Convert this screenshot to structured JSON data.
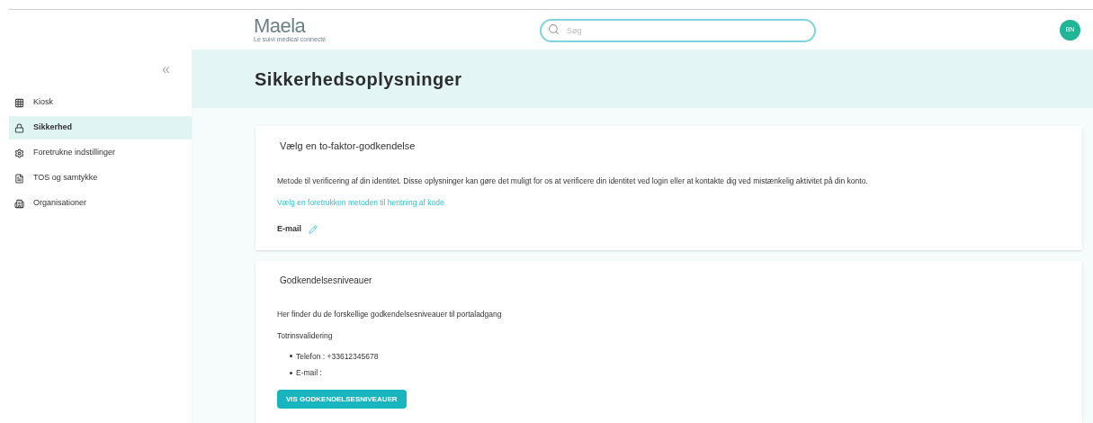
{
  "header": {
    "logo": "Maela",
    "tagline": "Le suivi médical connecté",
    "search": {
      "placeholder": "Søg"
    },
    "avatar": "BN"
  },
  "sidebar": {
    "collapse": "«",
    "items": [
      {
        "label": "Kiosk",
        "kind": "grid",
        "selected": false
      },
      {
        "label": "Sikkerhed",
        "kind": "lock",
        "selected": true
      },
      {
        "label": "Foretrukne indstillinger",
        "kind": "gear",
        "selected": false
      },
      {
        "label": "TOS og samtykke",
        "kind": "doc",
        "selected": false
      },
      {
        "label": "Organisationer",
        "kind": "building",
        "selected": false
      }
    ]
  },
  "page_title": "Sikkerhedsoplysninger",
  "two_factor": {
    "title": "Vælg en to-faktor-godkendelse",
    "description": "Metode til verificering af din identitet. Disse oplysninger kan gøre det muligt for os at verificere din identitet ved login eller at kontakte dig ved mistænkelig aktivitet på din konto.",
    "link": "Vælg en foretrukken metoden til hentning af kode",
    "method": "E-mail"
  },
  "levels": {
    "title": "Godkendelsesniveauer",
    "description": "Her finder du de forskellige godkendelsesniveauer til portaladgang",
    "subtitle": "Totrinsvalidering",
    "items": [
      "Telefon : +33612345678",
      "E-mail :"
    ],
    "button": "VIS GODKENDELSESNIVEAUER"
  }
}
